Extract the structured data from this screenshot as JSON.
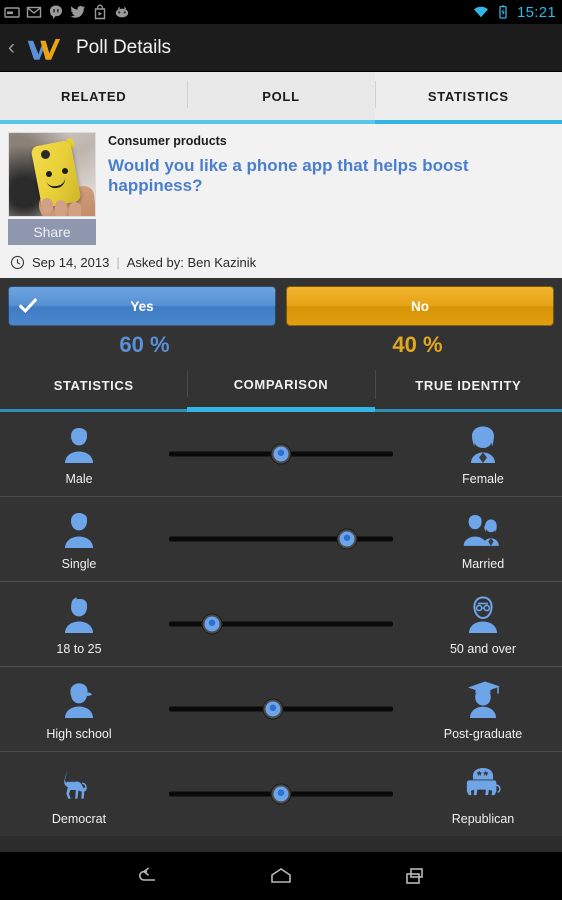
{
  "statusbar": {
    "icons": [
      "ticket-icon",
      "gmail-icon",
      "hangouts-icon",
      "twitter-icon",
      "play-store-icon",
      "game-controller-icon"
    ],
    "wifi_icon": "wifi-icon",
    "battery_icon": "battery-charging-icon",
    "time": "15:21",
    "accent_color": "#33b5e5"
  },
  "actionbar": {
    "back_glyph": "‹",
    "logo_name": "wisdo-w-logo",
    "title": "Poll Details"
  },
  "top_tabs": [
    {
      "label": "RELATED",
      "active": false
    },
    {
      "label": "POLL",
      "active": false
    },
    {
      "label": "STATISTICS",
      "active": true
    }
  ],
  "poll": {
    "category": "Consumer products",
    "question": "Would you like a phone app that helps boost happiness?",
    "share_label": "Share",
    "thumbnail_name": "poll-thumbnail-smiley-phone-case",
    "date": "Sep 14, 2013",
    "separator": "|",
    "asked_by": "Asked by: Ben Kazinik",
    "clock_icon": "clock-icon"
  },
  "vote": {
    "yes_label": "Yes",
    "no_label": "No",
    "yes_selected": true,
    "yes_percent": "60 %",
    "no_percent": "40 %",
    "yes_color": "#5b8fd8",
    "no_color": "#e3a81c"
  },
  "sub_tabs": [
    {
      "label": "STATISTICS",
      "active": false
    },
    {
      "label": "COMPARISON",
      "active": true
    },
    {
      "label": "TRUE IDENTITY",
      "active": false
    }
  ],
  "comparison_rows": [
    {
      "left_label": "Male",
      "left_icon": "male-avatar-icon",
      "right_label": "Female",
      "right_icon": "female-avatar-icon",
      "slider_percent": 50
    },
    {
      "left_label": "Single",
      "left_icon": "single-person-icon",
      "right_label": "Married",
      "right_icon": "married-couple-icon",
      "slider_percent": 76
    },
    {
      "left_label": "18 to 25",
      "left_icon": "young-person-icon",
      "right_label": "50 and over",
      "right_icon": "senior-glasses-icon",
      "slider_percent": 23
    },
    {
      "left_label": "High school",
      "left_icon": "high-school-cap-icon",
      "right_label": "Post-graduate",
      "right_icon": "graduation-cap-icon",
      "slider_percent": 47
    },
    {
      "left_label": "Democrat",
      "left_icon": "democrat-donkey-icon",
      "right_label": "Republican",
      "right_icon": "republican-elephant-icon",
      "slider_percent": 50
    }
  ],
  "navbar": {
    "back": "back-nav-icon",
    "home": "home-nav-icon",
    "recents": "recents-nav-icon"
  }
}
